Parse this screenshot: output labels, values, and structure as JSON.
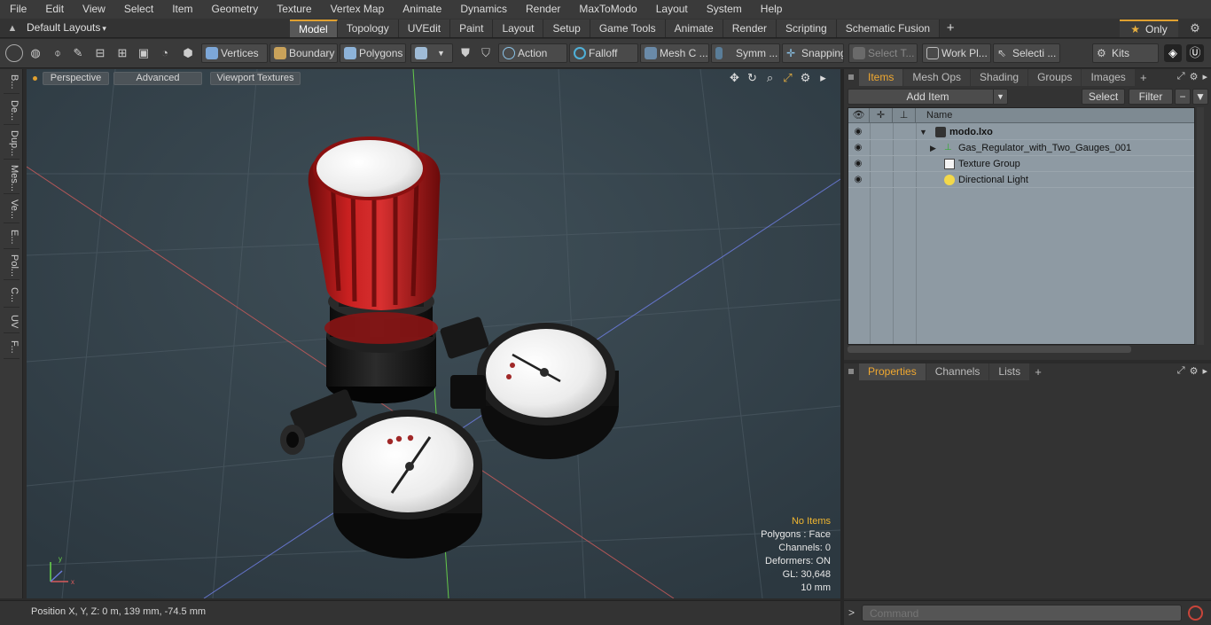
{
  "menu": [
    "File",
    "Edit",
    "View",
    "Select",
    "Item",
    "Geometry",
    "Texture",
    "Vertex Map",
    "Animate",
    "Dynamics",
    "Render",
    "MaxToModo",
    "Layout",
    "System",
    "Help"
  ],
  "layout": {
    "label": "Default Layouts",
    "caret": "▾"
  },
  "tabs": [
    "Model",
    "Topology",
    "UVEdit",
    "Paint",
    "Layout",
    "Setup",
    "Game Tools",
    "Animate",
    "Render",
    "Scripting",
    "Schematic Fusion"
  ],
  "tabs_plus": "+",
  "only_label": "Only",
  "toolbar": {
    "vertices": "Vertices",
    "boundary": "Boundary",
    "polygons": "Polygons",
    "action": "Action",
    "falloff": "Falloff",
    "mesh": "Mesh C ...",
    "symm": "Symm ...",
    "snapping": "Snapping",
    "select_t": "Select T...",
    "workpl": "Work Pl...",
    "selecti": "Selecti ...",
    "kits": "Kits"
  },
  "left_tabs": [
    "B...",
    "De...",
    "Dup...",
    "Mes...",
    "Ve...",
    "E...",
    "Pol...",
    "C...",
    "UV",
    "F..."
  ],
  "viewport": {
    "perspective": "Perspective",
    "advanced": "Advanced",
    "textures": "Viewport Textures",
    "info": {
      "items": "No Items",
      "polygons": "Polygons : Face",
      "channels": "Channels: 0",
      "deformers": "Deformers: ON",
      "gl": "GL: 30,648",
      "scale": "10 mm"
    }
  },
  "status": {
    "position": "Position X, Y, Z:   0 m, 139 mm, -74.5 mm"
  },
  "items_panel": {
    "tabs": [
      "Items",
      "Mesh Ops",
      "Shading",
      "Groups",
      "Images"
    ],
    "add_item": "Add Item",
    "select": "Select",
    "filter": "Filter",
    "col_name": "Name",
    "rows": [
      {
        "name": "modo.lxo"
      },
      {
        "name": "Gas_Regulator_with_Two_Gauges_001"
      },
      {
        "name": "Texture Group"
      },
      {
        "name": "Directional Light"
      }
    ]
  },
  "props_panel": {
    "tabs": [
      "Properties",
      "Channels",
      "Lists"
    ]
  },
  "command": {
    "placeholder": "Command"
  },
  "colors": {
    "accent": "#f0a830",
    "viewport_bg": "#3b4a52",
    "knob_red": "#b81c1c"
  }
}
